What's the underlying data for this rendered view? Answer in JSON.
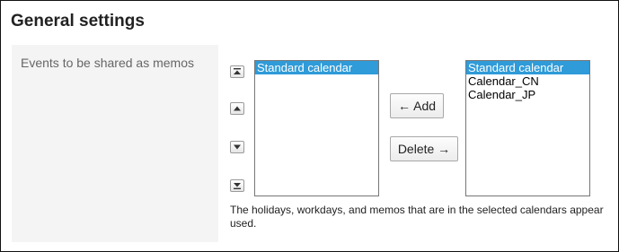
{
  "page": {
    "title": "General settings"
  },
  "setting": {
    "label": "Events to be shared as memos"
  },
  "order_buttons": [
    {
      "name": "move-to-top",
      "icon": "arrow-to-top-icon"
    },
    {
      "name": "move-up",
      "icon": "arrow-up-icon"
    },
    {
      "name": "move-down",
      "icon": "arrow-down-icon"
    },
    {
      "name": "move-to-bottom",
      "icon": "arrow-to-bottom-icon"
    }
  ],
  "selected_list": {
    "items": [
      {
        "label": "Standard calendar",
        "selected": true
      }
    ]
  },
  "available_list": {
    "items": [
      {
        "label": "Standard calendar",
        "selected": true
      },
      {
        "label": "Calendar_CN",
        "selected": false
      },
      {
        "label": "Calendar_JP",
        "selected": false
      }
    ]
  },
  "buttons": {
    "add_label": "← Add",
    "delete_label": "Delete →"
  },
  "help": {
    "line1": "The holidays, workdays, and memos that are in the selected calendars appear",
    "line2": "used."
  },
  "colors": {
    "selection": "#2f9bd8",
    "label_cell": "#f4f4f4"
  }
}
